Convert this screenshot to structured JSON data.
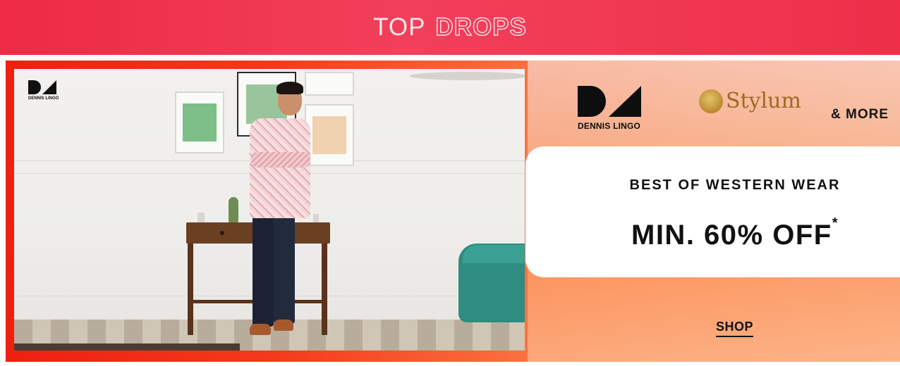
{
  "header": {
    "word1": "TOP",
    "word2": "DROPS"
  },
  "banner": {
    "photo_logo_text": "DENNIS LINGO",
    "brands": [
      {
        "name": "DENNIS LINGO"
      },
      {
        "name": "Stylum"
      }
    ],
    "more_text": "& MORE",
    "offer": {
      "subtitle": "BEST OF WESTERN WEAR",
      "headline": "MIN. 60% OFF",
      "asterisk": "*"
    },
    "cta_label": "SHOP"
  },
  "colors": {
    "header_bg": "#ee2a45",
    "banner_left": "#ee2010",
    "banner_right": "#f9c0a0",
    "text_dark": "#111111"
  }
}
